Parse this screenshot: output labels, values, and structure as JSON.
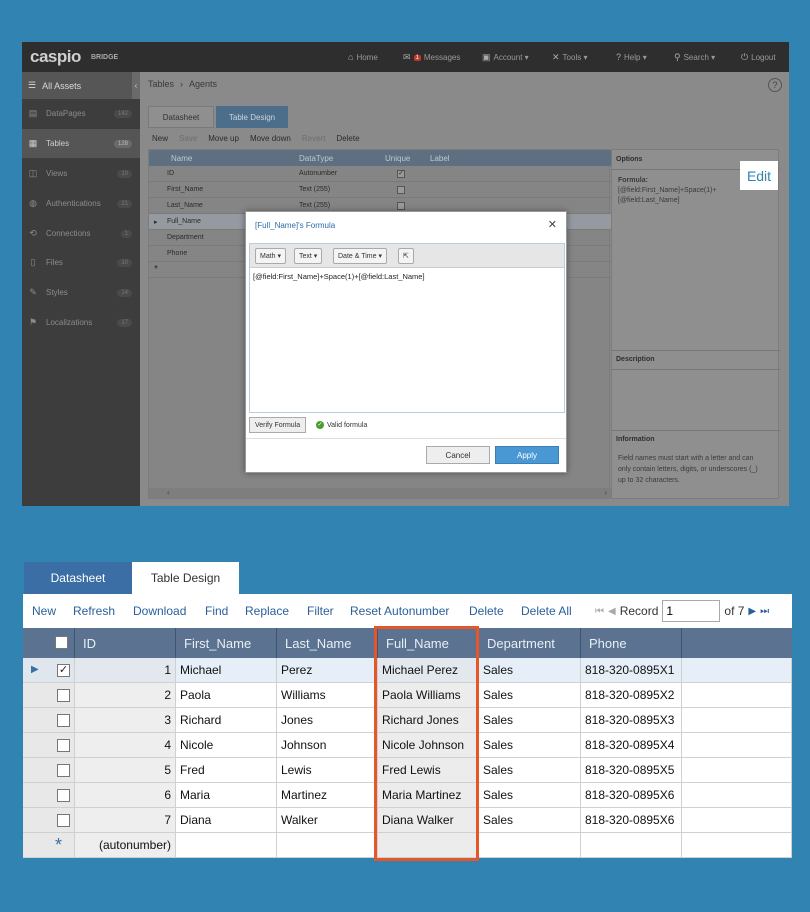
{
  "app": {
    "logo": "caspio",
    "logo_sub": "BRIDGE",
    "nav": [
      {
        "icon": "home-icon",
        "glyph": "⌂",
        "label": "Home"
      },
      {
        "icon": "mail-icon",
        "glyph": "✉",
        "label": "Messages",
        "badge": "1"
      },
      {
        "icon": "account-icon",
        "glyph": "▣",
        "label": "Account ▾"
      },
      {
        "icon": "tools-icon",
        "glyph": "✕",
        "label": "Tools ▾"
      },
      {
        "icon": "help-icon",
        "glyph": "?",
        "label": "Help ▾"
      },
      {
        "icon": "search-icon",
        "glyph": "⚲",
        "label": "Search ▾"
      },
      {
        "icon": "logout-icon",
        "glyph": "⏻",
        "label": "Logout"
      }
    ],
    "sidebar": {
      "all_assets": "All Assets",
      "items": [
        {
          "label": "DataPages",
          "count": "142",
          "glyph": "▤"
        },
        {
          "label": "Tables",
          "count": "128",
          "glyph": "▦",
          "active": true
        },
        {
          "label": "Views",
          "count": "10",
          "glyph": "◫"
        },
        {
          "label": "Authentications",
          "count": "21",
          "glyph": "◍"
        },
        {
          "label": "Connections",
          "count": "1",
          "glyph": "⟲"
        },
        {
          "label": "Files",
          "count": "10",
          "glyph": "▯"
        },
        {
          "label": "Styles",
          "count": "14",
          "glyph": "✎"
        },
        {
          "label": "Localizations",
          "count": "17",
          "glyph": "⚑"
        }
      ]
    },
    "breadcrumb": {
      "root": "Tables",
      "sep": "›",
      "current": "Agents"
    },
    "tabs": {
      "datasheet": "Datasheet",
      "design": "Table Design"
    },
    "toolbar": [
      "New",
      "Save",
      "Move up",
      "Move down",
      "Revert",
      "Delete"
    ],
    "grid_head": {
      "name": "Name",
      "type": "DataType",
      "unique": "Unique",
      "label": "Label"
    },
    "grid_rows": [
      {
        "name": "ID",
        "type": "Autonumber",
        "unique": true
      },
      {
        "name": "First_Name",
        "type": "Text (255)",
        "unique": false
      },
      {
        "name": "Last_Name",
        "type": "Text (255)",
        "unique": false
      },
      {
        "name": "Full_Name",
        "type": "",
        "unique": false
      },
      {
        "name": "Department",
        "type": "",
        "unique": false
      },
      {
        "name": "Phone",
        "type": "",
        "unique": false
      }
    ],
    "options": {
      "title": "Options",
      "formula_label": "Formula:",
      "formula_line1": "[@field:First_Name]+Space(1)+",
      "formula_line2": "[@field:Last_Name]",
      "desc_title": "Description",
      "info_title": "Information",
      "info_text1": "Field names must start with a letter and can",
      "info_text2": "only contain letters, digits, or underscores (_)",
      "info_text3": "up to 32 characters."
    },
    "edit_label": "Edit",
    "dialog": {
      "title": "[Full_Name]'s Formula",
      "buttons": [
        "Math ▾",
        "Text ▾",
        "Date & Time ▾"
      ],
      "formula": "[@field:First_Name]+Space(1)+[@field:Last_Name]",
      "verify": "Verify Formula",
      "valid": "Valid formula",
      "cancel": "Cancel",
      "apply": "Apply"
    }
  },
  "datasheet": {
    "tabs": {
      "datasheet": "Datasheet",
      "design": "Table Design"
    },
    "toolbar": [
      "New",
      "Refresh",
      "Download",
      "Find",
      "Replace",
      "Filter",
      "Reset Autonumber",
      "Delete",
      "Delete All"
    ],
    "pager": {
      "label": "Record",
      "value": "1",
      "of": "of 7"
    },
    "columns": [
      "ID",
      "First_Name",
      "Last_Name",
      "Full_Name",
      "Department",
      "Phone"
    ],
    "rows": [
      {
        "id": "1",
        "first": "Michael",
        "last": "Perez",
        "full": "Michael Perez",
        "dept": "Sales",
        "phone": "818-320-0895X1",
        "checked": true
      },
      {
        "id": "2",
        "first": "Paola",
        "last": "Williams",
        "full": "Paola Williams",
        "dept": "Sales",
        "phone": "818-320-0895X2",
        "checked": false
      },
      {
        "id": "3",
        "first": "Richard",
        "last": "Jones",
        "full": "Richard Jones",
        "dept": "Sales",
        "phone": "818-320-0895X3",
        "checked": false
      },
      {
        "id": "4",
        "first": "Nicole",
        "last": "Johnson",
        "full": "Nicole Johnson",
        "dept": "Sales",
        "phone": "818-320-0895X4",
        "checked": false
      },
      {
        "id": "5",
        "first": "Fred",
        "last": "Lewis",
        "full": "Fred Lewis",
        "dept": "Sales",
        "phone": "818-320-0895X5",
        "checked": false
      },
      {
        "id": "6",
        "first": "Maria",
        "last": "Martinez",
        "full": "Maria Martinez",
        "dept": "Sales",
        "phone": "818-320-0895X6",
        "checked": false
      },
      {
        "id": "7",
        "first": "Diana",
        "last": "Walker",
        "full": "Diana Walker",
        "dept": "Sales",
        "phone": "818-320-0895X6",
        "checked": false
      }
    ],
    "new_row_id": "(autonumber)",
    "accent": "#3a6ea5",
    "highlight": "#e3572a"
  }
}
